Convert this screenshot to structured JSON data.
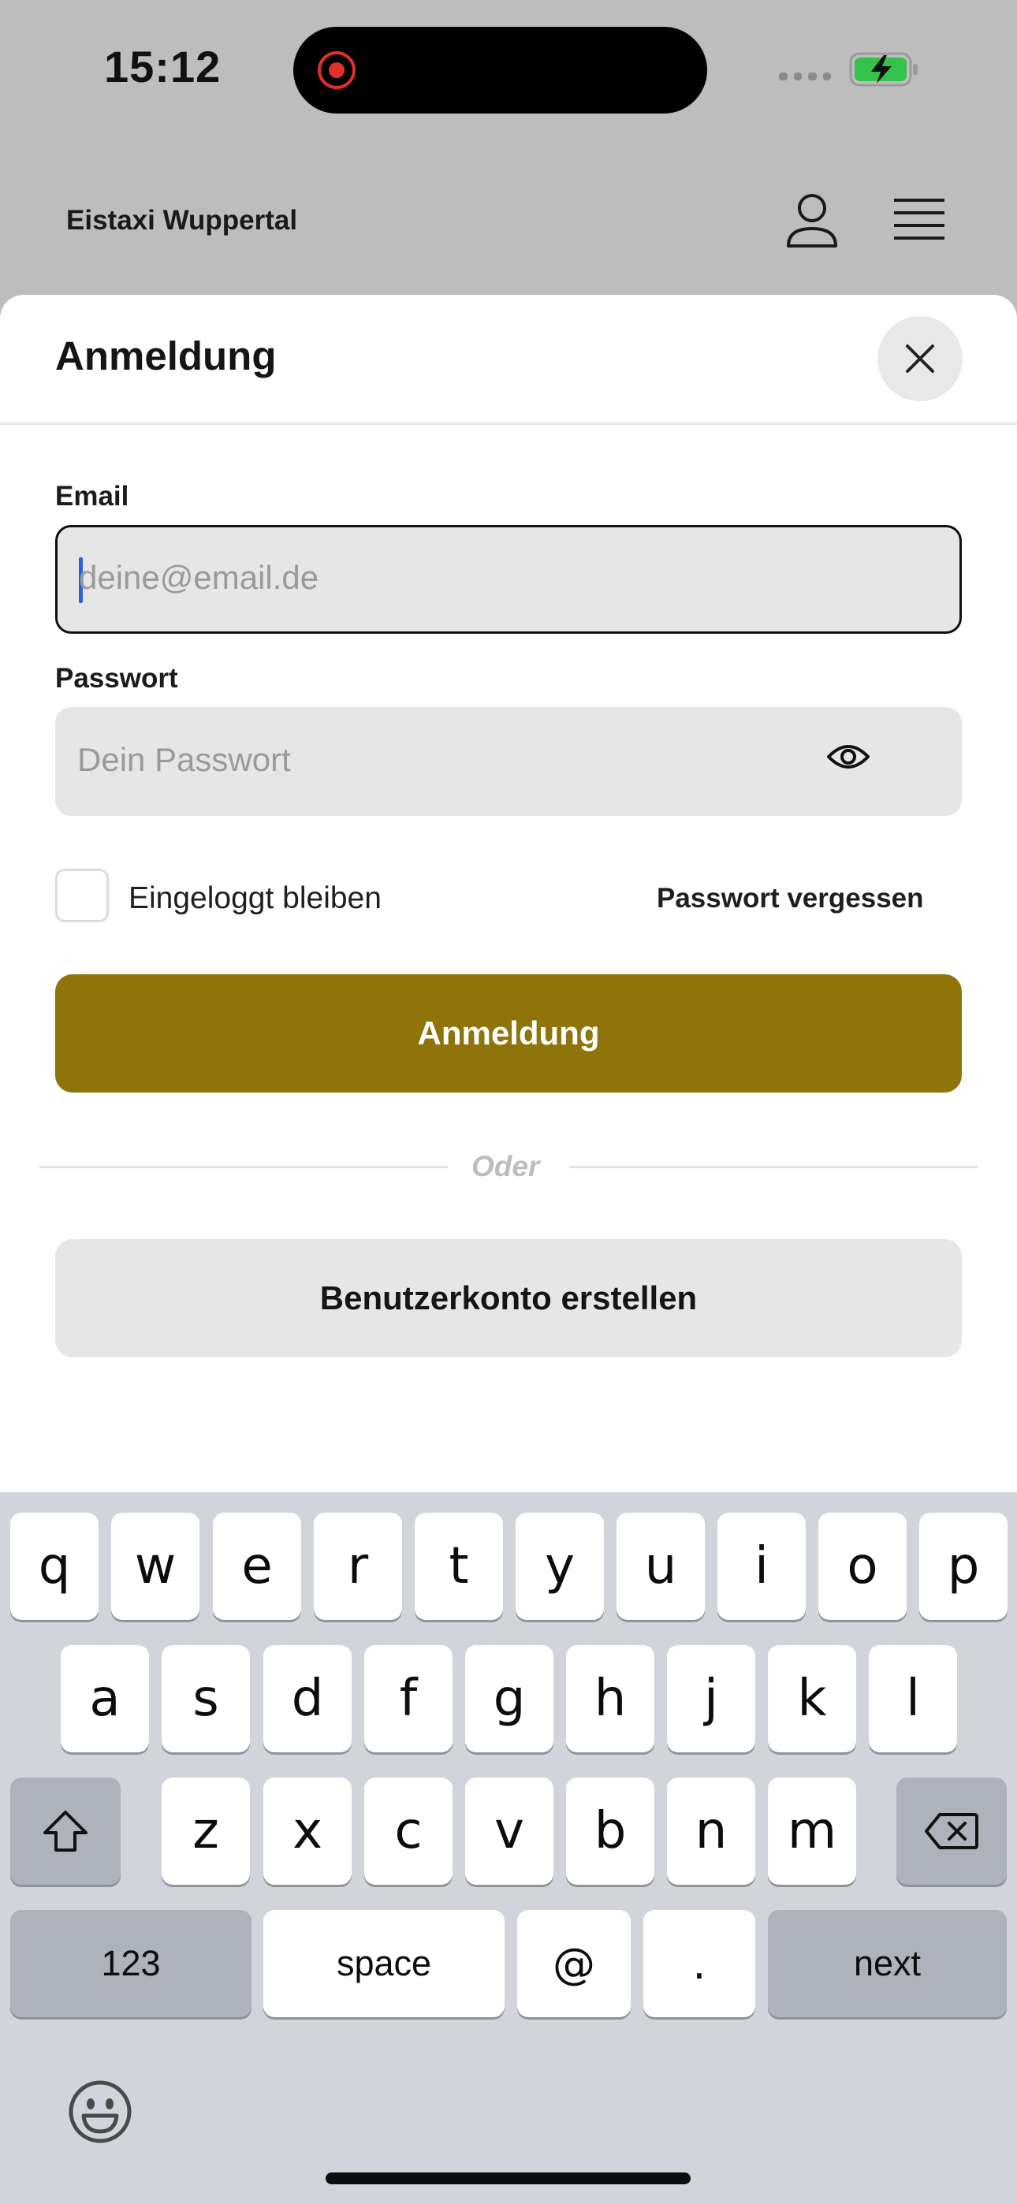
{
  "status_bar": {
    "time": "15:12"
  },
  "header": {
    "title": "Eistaxi Wuppertal"
  },
  "sheet": {
    "title": "Anmeldung",
    "email": {
      "label": "Email",
      "placeholder": "deine@email.de"
    },
    "password": {
      "label": "Passwort",
      "placeholder": "Dein Passwort"
    },
    "remember_label": "Eingeloggt bleiben",
    "forgot_label": "Passwort vergessen",
    "login_button": "Anmeldung",
    "or_label": "Oder",
    "signup_button": "Benutzerkonto erstellen",
    "accent_color": "#8f740a"
  },
  "keyboard": {
    "row1": [
      "q",
      "w",
      "e",
      "r",
      "t",
      "y",
      "u",
      "i",
      "o",
      "p"
    ],
    "row2": [
      "a",
      "s",
      "d",
      "f",
      "g",
      "h",
      "j",
      "k",
      "l"
    ],
    "row3": [
      "z",
      "x",
      "c",
      "v",
      "b",
      "n",
      "m"
    ],
    "numbers_key": "123",
    "space_key": "space",
    "at_key": "@",
    "dot_key": ".",
    "next_key": "next"
  }
}
